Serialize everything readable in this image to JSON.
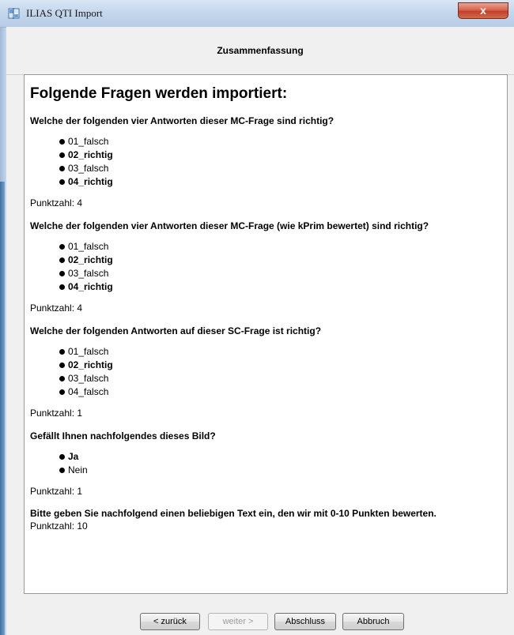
{
  "window": {
    "title": "ILIAS QTI Import",
    "close_symbol": "x"
  },
  "header": {
    "title": "Zusammenfassung"
  },
  "content": {
    "heading": "Folgende Fragen werden importiert:",
    "questions": [
      {
        "text": "Welche der folgenden vier Antworten dieser MC-Frage sind richtig?",
        "answers": [
          "01_falsch",
          "02_richtig",
          "03_falsch",
          "04_richtig"
        ],
        "points": "Punktzahl: 4"
      },
      {
        "text": "Welche der folgenden vier Antworten dieser MC-Frage (wie kPrim bewertet) sind richtig?",
        "answers": [
          "01_falsch",
          "02_richtig",
          "03_falsch",
          "04_richtig"
        ],
        "points": "Punktzahl: 4"
      },
      {
        "text": "Welche der folgenden Antworten auf dieser SC-Frage ist richtig?",
        "answers": [
          "01_falsch",
          "02_richtig",
          "03_falsch",
          "04_falsch"
        ],
        "points": "Punktzahl: 1"
      },
      {
        "text": "Gefällt Ihnen nachfolgendes dieses Bild?",
        "answers": [
          "Ja",
          "Nein"
        ],
        "points": "Punktzahl: 1"
      },
      {
        "text": "Bitte geben Sie nachfolgend einen beliebigen Text ein, den wir mit 0-10 Punkten bewerten.",
        "points": "Punktzahl: 10"
      }
    ]
  },
  "footer": {
    "back_label": "< zurück",
    "next_label": "weiter >",
    "finish_label": "Abschluss",
    "cancel_label": "Abbruch"
  }
}
